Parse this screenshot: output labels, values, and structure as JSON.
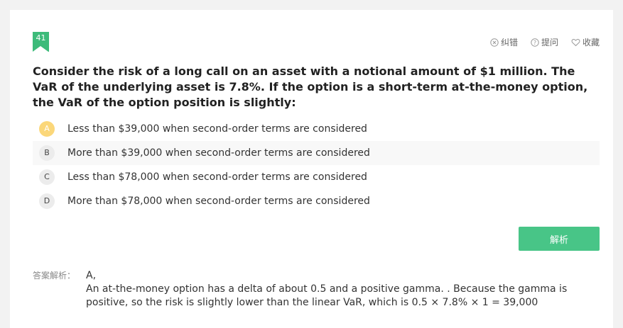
{
  "question": {
    "number": "41",
    "text": "Consider the risk of a long call on an asset with a notional amount of $1 million. The VaR of the underlying asset is 7.8%. If the option is a short-term at-the-money option, the VaR of the option position is slightly:"
  },
  "toolbar": {
    "report_label": "纠错",
    "ask_label": "提问",
    "favorite_label": "收藏"
  },
  "options": [
    {
      "letter": "A",
      "text": "Less than $39,000 when second-order terms are considered",
      "selected": true
    },
    {
      "letter": "B",
      "text": "More than $39,000 when second-order terms are considered",
      "selected": false
    },
    {
      "letter": "C",
      "text": "Less than $78,000 when second-order terms are considered",
      "selected": false
    },
    {
      "letter": "D",
      "text": "More than $78,000 when second-order terms are considered",
      "selected": false
    }
  ],
  "analyze_button": "解析",
  "answer": {
    "label": "答案解析：",
    "result": "A,",
    "explanation_line1": "An at-the-money option has a delta of about 0.5 and a positive gamma. . Because the gamma is",
    "explanation_line2": "positive, so the risk is slightly lower than the linear VaR, which is 0.5 × 7.8% × 1 = 39,000"
  },
  "colors": {
    "accent_green": "#48c587",
    "selected_option": "#fbd77a"
  }
}
